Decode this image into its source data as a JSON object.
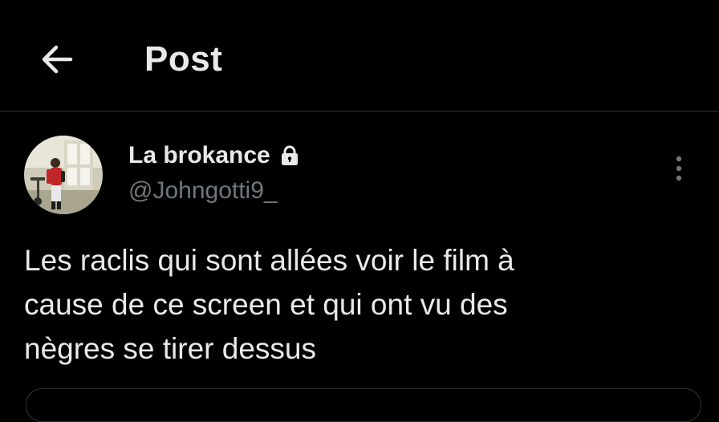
{
  "header": {
    "back_icon": "arrow-left-icon",
    "title": "Post"
  },
  "post": {
    "author": {
      "display_name": "La brokance",
      "handle": "@Johngotti9_",
      "protected_icon": "lock-icon",
      "avatar": "avatar-photo"
    },
    "more_icon": "more-vertical-icon",
    "text": "Les raclis qui sont allées voir le film à\ncause de ce screen et qui ont vu des\nnègres se tirer dessus"
  },
  "colors": {
    "background": "#000000",
    "text_primary": "#e7e9ea",
    "text_secondary": "#71767b",
    "divider": "#2f3336"
  }
}
